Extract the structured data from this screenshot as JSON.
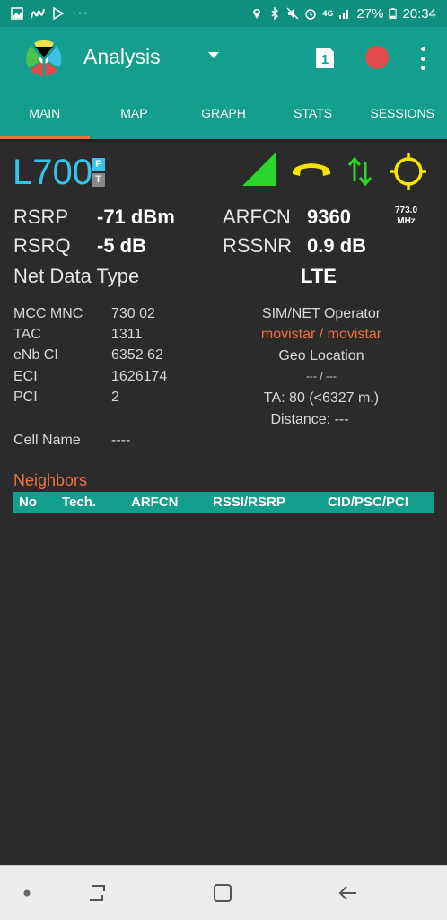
{
  "status_bar": {
    "battery": "27%",
    "time": "20:34",
    "network": "4G",
    "icons": [
      "gallery-icon",
      "movistar-icon",
      "play-store-icon",
      "more-dots-icon",
      "location-icon",
      "bluetooth-icon",
      "mute-icon",
      "alarm-icon",
      "signal-icon",
      "battery-icon"
    ]
  },
  "app_bar": {
    "title": "Analysis",
    "sim_label": "1",
    "record_color": "#e14b4b"
  },
  "tabs": [
    {
      "label": "MAIN"
    },
    {
      "label": "MAP"
    },
    {
      "label": "GRAPH"
    },
    {
      "label": "STATS"
    },
    {
      "label": "SESSIONS"
    }
  ],
  "active_tab": "MAIN",
  "cell": {
    "technology": "L700",
    "badge_f": "F",
    "badge_t": "T",
    "frequency": "773.0",
    "frequency_unit": "MHz"
  },
  "metrics": {
    "rsrp_label": "RSRP",
    "rsrp_value": "-71 dBm",
    "rsrq_label": "RSRQ",
    "rsrq_value": "-5 dB",
    "arfcn_label": "ARFCN",
    "arfcn_value": "9360",
    "rssnr_label": "RSSNR",
    "rssnr_value": "0.9 dB",
    "net_data_type_label": "Net Data Type",
    "net_data_type_value": "LTE"
  },
  "details": {
    "mcc_mnc_label": "MCC MNC",
    "mcc_mnc_value": "730 02",
    "tac_label": "TAC",
    "tac_value": "1311",
    "enb_ci_label": "eNb CI",
    "enb_ci_value": "6352 62",
    "eci_label": "ECI",
    "eci_value": "1626174",
    "pci_label": "PCI",
    "pci_value": "2",
    "cell_name_label": "Cell Name",
    "cell_name_value": "----"
  },
  "operator": {
    "label": "SIM/NET Operator",
    "value": "movistar / movistar",
    "geo_label": "Geo Location",
    "geo_value": "--- / ---",
    "ta": "TA: 80 (<6327 m.)",
    "distance": "Distance: ---"
  },
  "neighbors": {
    "title": "Neighbors",
    "columns": [
      "No",
      "Tech.",
      "ARFCN",
      "RSSI/RSRP",
      "CID/PSC/PCI"
    ]
  },
  "colors": {
    "accent": "#139e8e",
    "highlight": "#f07040",
    "tech": "#35c4e8",
    "signal": "#2bd62b",
    "call": "#f5e400",
    "gps": "#f5e400"
  }
}
